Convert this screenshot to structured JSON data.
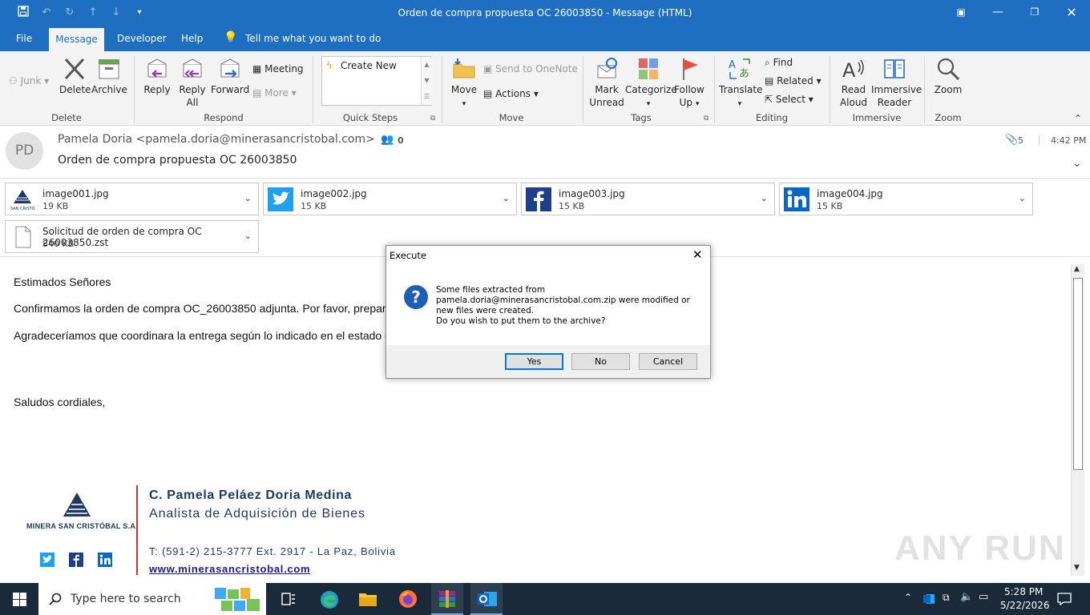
{
  "window": {
    "title": "Orden de compra propuesta OC 26003850  -  Message (HTML)"
  },
  "menu": {
    "file": "File",
    "message": "Message",
    "developer": "Developer",
    "help": "Help",
    "tell_me": "Tell me what you want to do"
  },
  "ribbon": {
    "junk": "Junk",
    "delete": "Delete",
    "archive": "Archive",
    "group_delete": "Delete",
    "reply": "Reply",
    "reply_all_1": "Reply",
    "reply_all_2": "All",
    "forward": "Forward",
    "meeting": "Meeting",
    "more": "More",
    "group_respond": "Respond",
    "create_new": "Create New",
    "group_quick_steps": "Quick Steps",
    "move": "Move",
    "send_onenote": "Send to OneNote",
    "actions": "Actions",
    "group_move": "Move",
    "mark_unread_1": "Mark",
    "mark_unread_2": "Unread",
    "categorize": "Categorize",
    "follow_up_1": "Follow",
    "follow_up_2": "Up",
    "group_tags": "Tags",
    "translate": "Translate",
    "find": "Find",
    "related": "Related",
    "select": "Select",
    "group_editing": "Editing",
    "read_aloud_1": "Read",
    "read_aloud_2": "Aloud",
    "immersive_1": "Immersive",
    "immersive_2": "Reader",
    "group_immersive": "Immersive",
    "zoom": "Zoom",
    "group_zoom": "Zoom"
  },
  "header": {
    "avatar_initials": "PD",
    "from": "Pamela Doria <pamela.doria@minerasancristobal.com>",
    "people_count": "0",
    "subject": "Orden de compra propuesta OC 26003850",
    "attachment_count": "5",
    "time": "4:42 PM"
  },
  "attachments": [
    {
      "name": "image001.jpg",
      "size": "19 KB",
      "icon": "minera-logo-icon"
    },
    {
      "name": "image002.jpg",
      "size": "15 KB",
      "icon": "twitter-icon"
    },
    {
      "name": "image003.jpg",
      "size": "15 KB",
      "icon": "facebook-icon"
    },
    {
      "name": "image004.jpg",
      "size": "15 KB",
      "icon": "linkedin-icon"
    },
    {
      "name": "Solicitud de orden de compra OC 26003850.zst",
      "size": "840 KB",
      "icon": "file-icon"
    }
  ],
  "logo_small_text": "SAN CRISTÓ",
  "body": {
    "greeting": "Estimados Señores",
    "line1": "Confirmamos la orden de compra OC_26003850 adjunta. Por favor, prepar",
    "line2": "Agradeceríamos que coordinara la entrega según lo indicado en el estado d",
    "closing": "Saludos cordiales,"
  },
  "signature": {
    "company": "MINERA SAN CRISTÓBAL S.A.",
    "name": "C. Pamela Peláez Doria Medina",
    "role": "Analista de Adquisición de Bienes",
    "phone": "T: (591-2) 215-3777 Ext. 2917 - La Paz, Bolivia",
    "website": "www.minerasancristobal.com"
  },
  "dialog": {
    "title": "Execute",
    "msg1": "Some files extracted from",
    "msg2": "pamela.doria@minerasancristobal.com.zip were modified or",
    "msg3": "new files were created.",
    "msg4": "Do you wish to put them to the archive?",
    "yes": "Yes",
    "no": "No",
    "cancel": "Cancel"
  },
  "watermark": "ANY RUN",
  "taskbar": {
    "search_placeholder": "Type here to search",
    "time": "5:28 PM",
    "date": "5/22/2026"
  },
  "colors": {
    "accent": "#1e6fc2",
    "taskbar": "#1b2a3a",
    "link": "#1a1a8c",
    "sig_text": "#1f3864"
  }
}
